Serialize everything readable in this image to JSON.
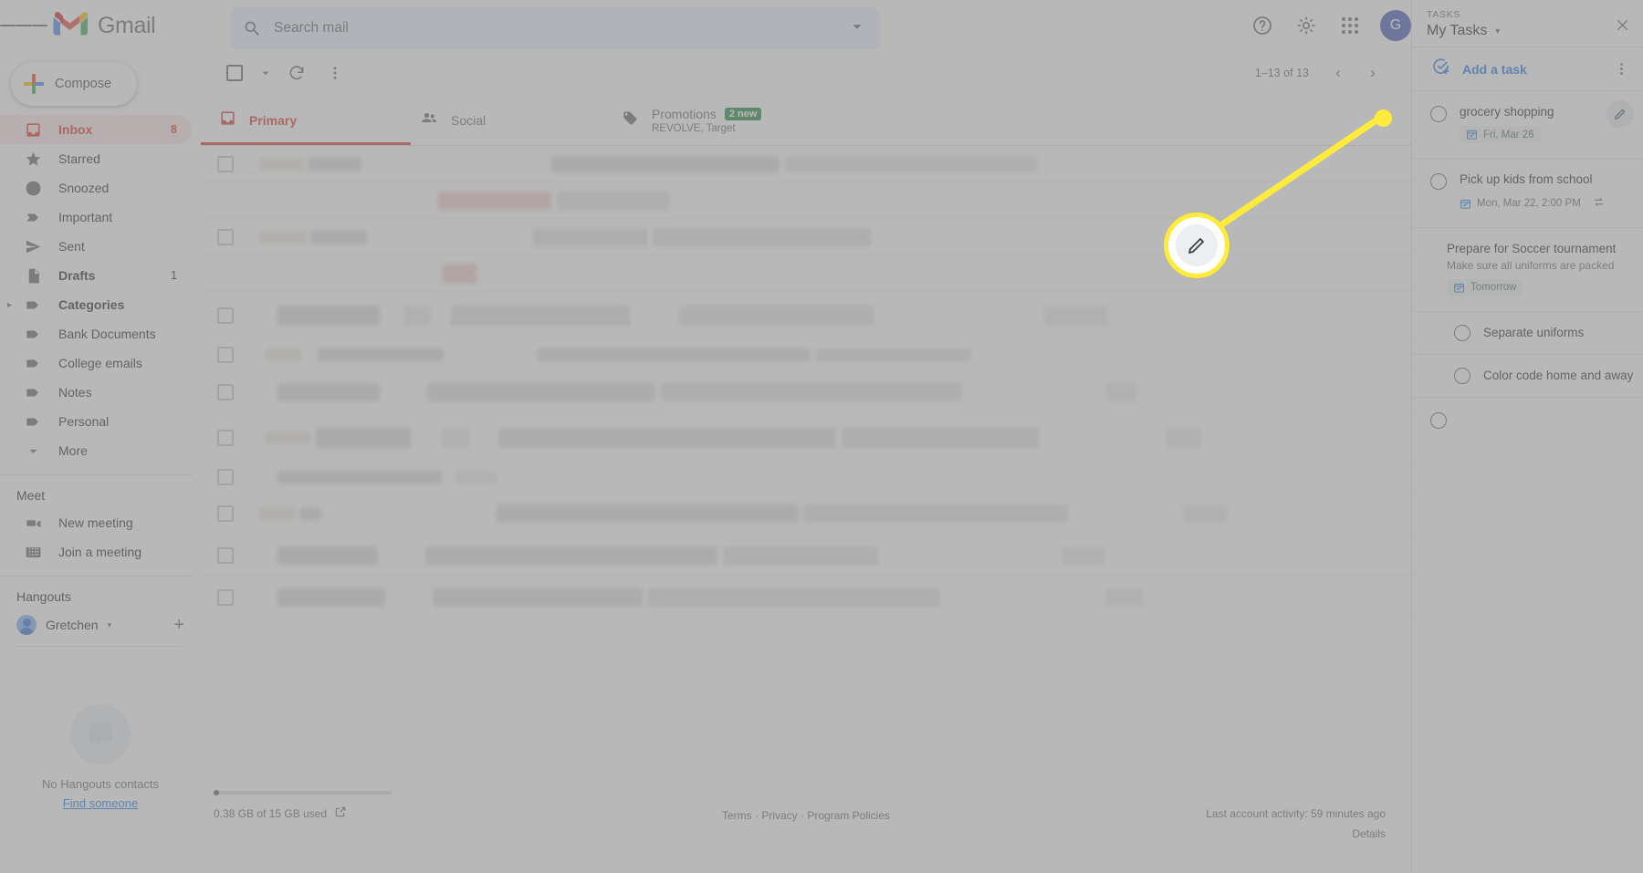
{
  "topbar": {
    "app_name": "Gmail",
    "menu_icon": "hamburger-icon",
    "search_placeholder": "Search mail",
    "search_value": "",
    "help_icon": "help-icon",
    "settings_icon": "gear-icon",
    "apps_icon": "apps-grid-icon",
    "avatar_letter": "G"
  },
  "compose": {
    "label": "Compose"
  },
  "sidebar": {
    "items": [
      {
        "label": "Inbox",
        "icon": "inbox-icon",
        "count": "8",
        "active": true,
        "bold": true
      },
      {
        "label": "Starred",
        "icon": "star-icon",
        "count": ""
      },
      {
        "label": "Snoozed",
        "icon": "clock-icon",
        "count": ""
      },
      {
        "label": "Important",
        "icon": "label-important-icon",
        "count": ""
      },
      {
        "label": "Sent",
        "icon": "send-icon",
        "count": ""
      },
      {
        "label": "Drafts",
        "icon": "draft-icon",
        "count": "1",
        "bold": true
      },
      {
        "label": "Categories",
        "icon": "label-icon",
        "count": "",
        "bold": true,
        "expandable": true
      },
      {
        "label": "Bank Documents",
        "icon": "label-icon",
        "count": ""
      },
      {
        "label": "College emails",
        "icon": "label-icon",
        "count": ""
      },
      {
        "label": "Notes",
        "icon": "label-icon",
        "count": ""
      },
      {
        "label": "Personal",
        "icon": "label-icon",
        "count": ""
      },
      {
        "label": "More",
        "icon": "chevron-down-icon",
        "count": ""
      }
    ],
    "meet": {
      "heading": "Meet",
      "items": [
        {
          "label": "New meeting",
          "icon": "video-camera-icon"
        },
        {
          "label": "Join a meeting",
          "icon": "keyboard-icon"
        }
      ]
    },
    "hangouts": {
      "heading": "Hangouts",
      "user": "Gretchen",
      "add_icon": "plus-icon",
      "empty_text": "No Hangouts contacts",
      "empty_link": "Find someone"
    }
  },
  "mail_toolbar": {
    "select_all_icon": "checkbox-icon",
    "select_caret_icon": "chevron-down-icon",
    "refresh_icon": "refresh-icon",
    "more_icon": "more-vert-icon",
    "pager_range": "1–13 of 13",
    "prev_icon": "chevron-left-icon",
    "next_icon": "chevron-right-icon"
  },
  "mail_tabs": [
    {
      "label": "Primary",
      "icon": "inbox-icon",
      "selected": true,
      "sub": "",
      "badge": ""
    },
    {
      "label": "Social",
      "icon": "people-icon",
      "selected": false,
      "sub": "",
      "badge": ""
    },
    {
      "label": "Promotions",
      "icon": "tag-icon",
      "selected": false,
      "sub": "REVOLVE, Target",
      "badge": "2 new"
    }
  ],
  "footer": {
    "storage": "0.38 GB of 15 GB used",
    "storage_link_icon": "open-in-new-icon",
    "links": "Terms · Privacy · Program Policies",
    "activity": "Last account activity: 59 minutes ago",
    "details": "Details"
  },
  "side_rail": [
    {
      "icon": "google-calendar-icon",
      "active": false
    },
    {
      "icon": "google-keep-icon",
      "active": false
    },
    {
      "icon": "google-tasks-icon",
      "active": true
    },
    {
      "icon": "google-contacts-icon",
      "active": false
    }
  ],
  "tasks_panel": {
    "kicker": "TASKS",
    "list_name": "My Tasks",
    "list_caret_icon": "chevron-down-icon",
    "close_icon": "close-icon",
    "add_task_label": "Add a task",
    "add_task_icon": "add-task-icon",
    "more_icon": "more-vert-icon",
    "edit_icon": "pencil-icon",
    "items": [
      {
        "title": "grocery shopping",
        "description": "",
        "date": "Fri, Mar 26",
        "date_icon": "calendar-icon",
        "repeat": false,
        "sub": false,
        "has_edit": true
      },
      {
        "title": "Pick up kids from school",
        "description": "",
        "date": "Mon, Mar 22, 2:00 PM",
        "date_icon": "calendar-icon",
        "repeat": true,
        "sub": false,
        "has_edit": false
      },
      {
        "title": "Prepare for Soccer tournament",
        "description": "Make sure all uniforms are packed",
        "date": "Tomorrow",
        "date_icon": "calendar-icon",
        "repeat": false,
        "sub": false,
        "has_edit": false
      },
      {
        "title": "Separate uniforms",
        "description": "",
        "date": "",
        "date_icon": "",
        "repeat": false,
        "sub": true,
        "has_edit": false
      },
      {
        "title": "Color code home and away",
        "description": "",
        "date": "",
        "date_icon": "",
        "repeat": false,
        "sub": true,
        "has_edit": false
      }
    ],
    "empty_row": true
  },
  "callout": {
    "highlight_icon": "pencil-icon",
    "line_color": "#ffeb3b"
  },
  "colors": {
    "accent_red": "#d93025",
    "accent_blue": "#1a73e8",
    "badge_green": "#188038",
    "highlight_yellow": "#ffeb3b"
  }
}
